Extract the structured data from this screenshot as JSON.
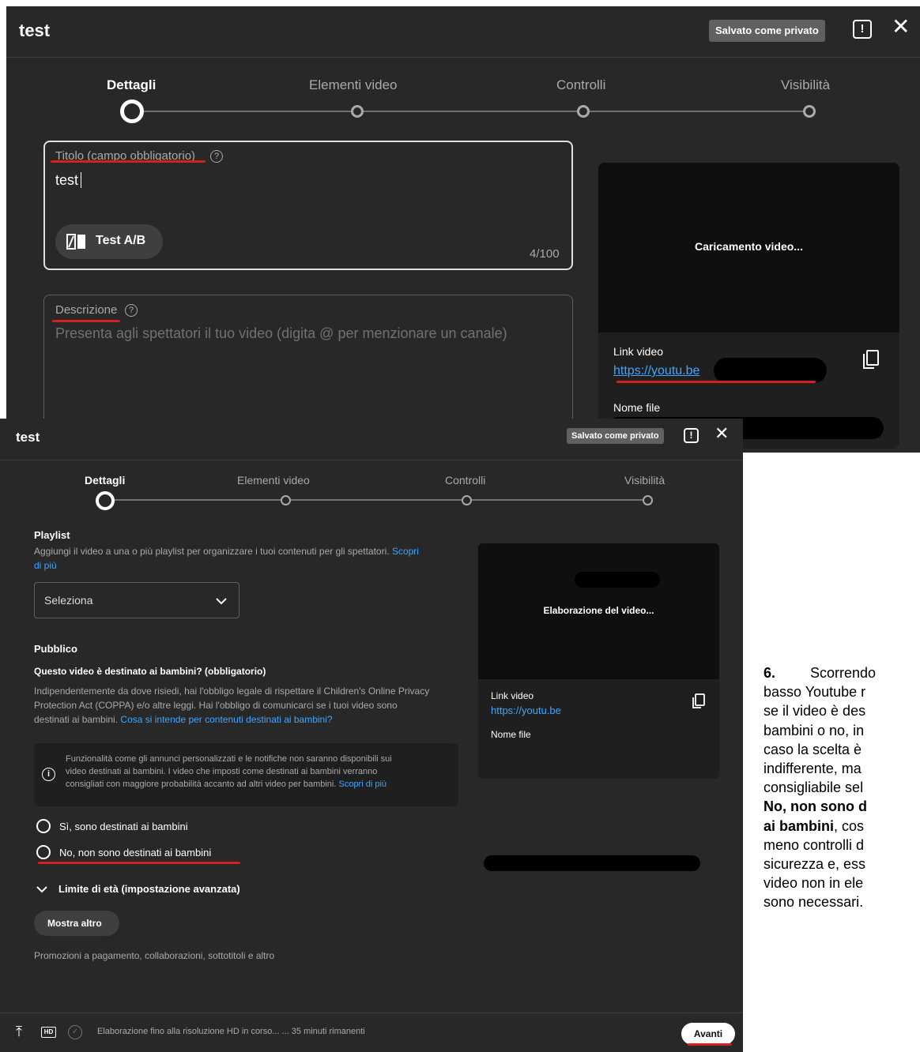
{
  "dialog1": {
    "title": "test",
    "saved_badge": "Salvato come privato",
    "feedback_icon": "feedback-icon",
    "close_icon": "close-icon",
    "steps": [
      "Dettagli",
      "Elementi video",
      "Controlli",
      "Visibilità"
    ],
    "title_field": {
      "label": "Titolo (campo obbligatorio)",
      "value": "test",
      "counter": "4/100",
      "ab_button": "Test A/B"
    },
    "description_field": {
      "label": "Descrizione",
      "placeholder": "Presenta agli spettatori il tuo video (digita @ per menzionare un canale)"
    },
    "preview": {
      "status": "Caricamento video...",
      "link_label": "Link video",
      "link": "https://youtu.be",
      "file_label": "Nome file"
    }
  },
  "dialog2": {
    "title": "test",
    "saved_badge": "Salvato come privato",
    "steps": [
      "Dettagli",
      "Elementi video",
      "Controlli",
      "Visibilità"
    ],
    "playlist": {
      "heading": "Playlist",
      "text": "Aggiungi il video a una o più playlist per organizzare i tuoi contenuti per gli spettatori.",
      "link1": "Scopri",
      "link2": "di più",
      "select": "Seleziona"
    },
    "audience": {
      "heading": "Pubblico",
      "question": "Questo video è destinato ai bambini? (obbligatorio)",
      "text1": "Indipendentemente da dove risiedi, hai l'obbligo legale di rispettare il Children's Online Privacy",
      "text2": "Protection Act (COPPA) e/o altre leggi. Hai l'obbligo di comunicarci se i tuoi video sono",
      "text3": "destinati ai bambini.",
      "text3_link": "Cosa si intende per contenuti destinati ai bambini?",
      "note1": "Funzionalità come gli annunci personalizzati e le notifiche non saranno disponibili sui",
      "note2": "video destinati ai bambini. I video che imposti come destinati ai bambini verranno",
      "note3": "consigliati con maggiore probabilità accanto ad altri video per bambini.",
      "note3_link": "Scopri di più",
      "option_yes": "Sì, sono destinati ai bambini",
      "option_no": "No, non sono destinati ai bambini"
    },
    "age_limit": "Limite di età (impostazione avanzata)",
    "show_more": "Mostra altro",
    "more_text": "Promozioni a pagamento, collaborazioni, sottotitoli e altro",
    "preview": {
      "status": "Elaborazione del video...",
      "link_label": "Link video",
      "link": "https://youtu.be",
      "file_label": "Nome file"
    },
    "footer": {
      "hd_badge": "HD",
      "status": "Elaborazione fino alla risoluzione HD in corso... ... 35 minuti rimanenti",
      "next": "Avanti"
    }
  },
  "side_text": {
    "num": "6.",
    "l1": "Scorrendo",
    "l2": "basso Youtube r",
    "l3": "se il video è des",
    "l4": "bambini o no, in",
    "l5": "caso la scelta è",
    "l6": "indifferente, ma",
    "l7": "consigliabile sel",
    "l8": "No, non sono d",
    "l9": "ai bambini",
    "l9b": ", cos",
    "l10": "meno controlli d",
    "l11": "sicurezza e, ess",
    "l12": "video non in ele",
    "l13": "sono necessari."
  }
}
